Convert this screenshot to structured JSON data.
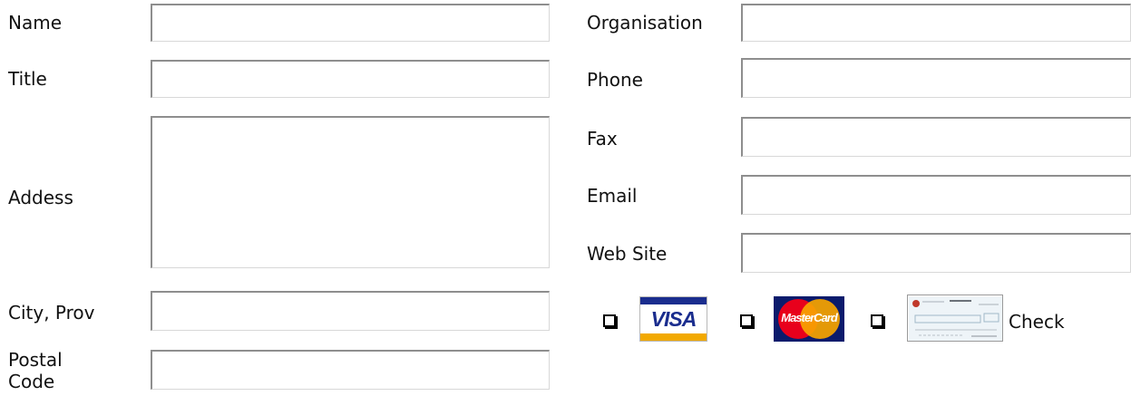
{
  "left_fields": [
    {
      "label": "Name"
    },
    {
      "label": "Title"
    },
    {
      "label": "Addess"
    },
    {
      "label": "City, Prov"
    },
    {
      "label": "Postal Code"
    }
  ],
  "right_fields": [
    {
      "label": "Organisation"
    },
    {
      "label": "Phone"
    },
    {
      "label": "Fax"
    },
    {
      "label": "Email"
    },
    {
      "label": "Web Site"
    }
  ],
  "payment": {
    "visa_label": "VISA",
    "mastercard_label": "MasterCard",
    "check_label": "Check",
    "visa_colors": {
      "blue": "#1a2d8e",
      "gold": "#f2a900"
    },
    "mastercard_colors": {
      "red": "#e8001c",
      "yellow": "#f7a400",
      "navy": "#0b1b6c"
    }
  }
}
